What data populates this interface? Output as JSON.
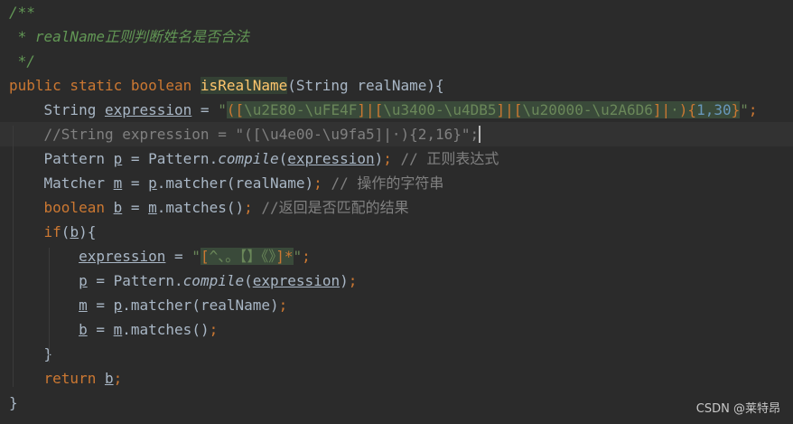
{
  "editor": {
    "lines": [
      [
        {
          "t": "/**",
          "c": "doc"
        }
      ],
      [
        {
          "t": " * realName",
          "c": "doc"
        },
        {
          "t": "正则判断姓名是否合法",
          "c": "doc"
        }
      ],
      [
        {
          "t": " */",
          "c": "doc"
        }
      ],
      [
        {
          "t": "public static boolean ",
          "c": "kw"
        },
        {
          "t": "isRealName",
          "c": "fn hl-name"
        },
        {
          "t": "(String realName){",
          "c": ""
        }
      ],
      [
        {
          "t": "    String ",
          "c": ""
        },
        {
          "t": "expression",
          "c": "ul"
        },
        {
          "t": " = ",
          "c": ""
        },
        {
          "t": "\"",
          "c": "str"
        },
        {
          "t": "([",
          "c": "esc"
        },
        {
          "t": "\\u2E80-\\uFE4F",
          "c": "str hl-bg"
        },
        {
          "t": "]|[",
          "c": "esc"
        },
        {
          "t": "\\u3400-\\u4DB5",
          "c": "str hl-bg"
        },
        {
          "t": "]|[",
          "c": "esc"
        },
        {
          "t": "\\u20000-\\u2A6D6",
          "c": "str hl-bg"
        },
        {
          "t": "]|",
          "c": "esc"
        },
        {
          "t": "·",
          "c": "str hl-bg"
        },
        {
          "t": "){",
          "c": "esc"
        },
        {
          "t": "1,30",
          "c": "num hl-bg"
        },
        {
          "t": "}",
          "c": "esc"
        },
        {
          "t": "\"",
          "c": "str"
        },
        {
          "t": ";",
          "c": "kw"
        }
      ],
      [
        {
          "t": "    //String expression = \"([\\u4e00-\\u9fa5]|·){2,16}\";",
          "c": "cmt"
        }
      ],
      [
        {
          "t": "    Pattern ",
          "c": ""
        },
        {
          "t": "p",
          "c": "ul"
        },
        {
          "t": " = Pattern.",
          "c": ""
        },
        {
          "t": "compile",
          "c": "it"
        },
        {
          "t": "(",
          "c": ""
        },
        {
          "t": "expression",
          "c": "ul"
        },
        {
          "t": ")",
          "c": ""
        },
        {
          "t": ";",
          "c": "kw"
        },
        {
          "t": " // 正则表达式",
          "c": "cmt"
        }
      ],
      [
        {
          "t": "    Matcher ",
          "c": ""
        },
        {
          "t": "m",
          "c": "ul"
        },
        {
          "t": " = ",
          "c": ""
        },
        {
          "t": "p",
          "c": "ul"
        },
        {
          "t": ".matcher(realName)",
          "c": ""
        },
        {
          "t": ";",
          "c": "kw"
        },
        {
          "t": " // 操作的字符串",
          "c": "cmt"
        }
      ],
      [
        {
          "t": "    ",
          "c": ""
        },
        {
          "t": "boolean ",
          "c": "kw"
        },
        {
          "t": "b",
          "c": "ul"
        },
        {
          "t": " = ",
          "c": ""
        },
        {
          "t": "m",
          "c": "ul"
        },
        {
          "t": ".matches()",
          "c": ""
        },
        {
          "t": ";",
          "c": "kw"
        },
        {
          "t": " //返回是否匹配的结果",
          "c": "cmt"
        }
      ],
      [
        {
          "t": "    ",
          "c": ""
        },
        {
          "t": "if",
          "c": "kw"
        },
        {
          "t": "(",
          "c": ""
        },
        {
          "t": "b",
          "c": "ul"
        },
        {
          "t": "){",
          "c": ""
        }
      ],
      [
        {
          "t": "        ",
          "c": ""
        },
        {
          "t": "expression",
          "c": "ul"
        },
        {
          "t": " = ",
          "c": ""
        },
        {
          "t": "\"",
          "c": "str"
        },
        {
          "t": "[",
          "c": "esc"
        },
        {
          "t": "^、。【】《》",
          "c": "str hl-bg"
        },
        {
          "t": "]",
          "c": "esc"
        },
        {
          "t": "*",
          "c": "esc"
        },
        {
          "t": "\"",
          "c": "str"
        },
        {
          "t": ";",
          "c": "kw"
        }
      ],
      [
        {
          "t": "        ",
          "c": ""
        },
        {
          "t": "p",
          "c": "ul"
        },
        {
          "t": " = Pattern.",
          "c": ""
        },
        {
          "t": "compile",
          "c": "it"
        },
        {
          "t": "(",
          "c": ""
        },
        {
          "t": "expression",
          "c": "ul"
        },
        {
          "t": ")",
          "c": ""
        },
        {
          "t": ";",
          "c": "kw"
        }
      ],
      [
        {
          "t": "        ",
          "c": ""
        },
        {
          "t": "m",
          "c": "ul"
        },
        {
          "t": " = ",
          "c": ""
        },
        {
          "t": "p",
          "c": "ul"
        },
        {
          "t": ".matcher(realName)",
          "c": ""
        },
        {
          "t": ";",
          "c": "kw"
        }
      ],
      [
        {
          "t": "        ",
          "c": ""
        },
        {
          "t": "b",
          "c": "ul"
        },
        {
          "t": " = ",
          "c": ""
        },
        {
          "t": "m",
          "c": "ul"
        },
        {
          "t": ".matches()",
          "c": ""
        },
        {
          "t": ";",
          "c": "kw"
        }
      ],
      [
        {
          "t": "    }",
          "c": ""
        }
      ],
      [
        {
          "t": "    ",
          "c": ""
        },
        {
          "t": "return ",
          "c": "kw"
        },
        {
          "t": "b",
          "c": "ul"
        },
        {
          "t": ";",
          "c": "kw"
        }
      ],
      [
        {
          "t": "}",
          "c": ""
        }
      ]
    ]
  },
  "watermark": "CSDN @莱特昂"
}
